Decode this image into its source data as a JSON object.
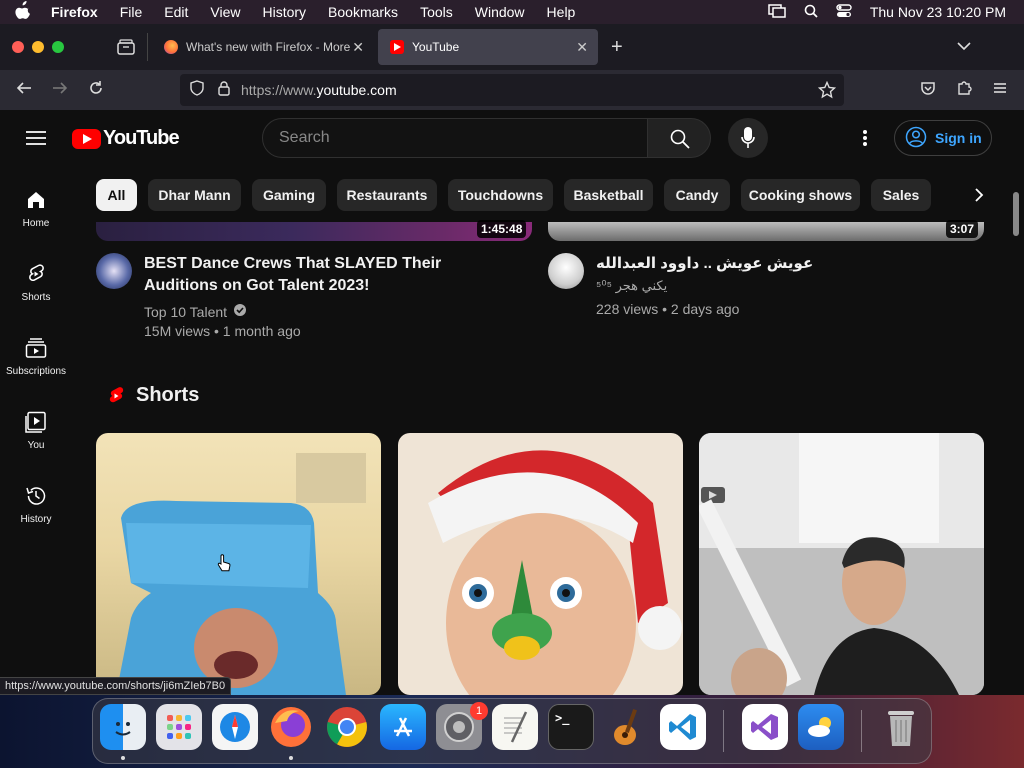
{
  "menubar": {
    "app": "Firefox",
    "items": [
      "File",
      "Edit",
      "View",
      "History",
      "Bookmarks",
      "Tools",
      "Window",
      "Help"
    ],
    "clock": "Thu Nov 23  10:20 PM"
  },
  "tabs": [
    {
      "title": "What's new with Firefox - More",
      "active": false
    },
    {
      "title": "YouTube",
      "active": true
    }
  ],
  "address": {
    "prefix": "https://www.",
    "domain": "youtube.com"
  },
  "youtube": {
    "logo": "YouTube",
    "search_placeholder": "Search",
    "signin_label": "Sign in",
    "chips": [
      "All",
      "Dhar Mann",
      "Gaming",
      "Restaurants",
      "Touchdowns",
      "Basketball",
      "Candy",
      "Cooking shows",
      "Sales"
    ],
    "sidebar": [
      {
        "label": "Home",
        "icon": "home-icon"
      },
      {
        "label": "Shorts",
        "icon": "shorts-icon"
      },
      {
        "label": "Subscriptions",
        "icon": "subscriptions-icon"
      },
      {
        "label": "You",
        "icon": "you-icon"
      },
      {
        "label": "History",
        "icon": "history-icon"
      }
    ],
    "videos": [
      {
        "title": "BEST Dance Crews That SLAYED Their Auditions on Got Talent 2023!",
        "channel": "Top 10 Talent",
        "verified": true,
        "stats": "15M views • 1 month ago",
        "duration": "1:45:48"
      },
      {
        "title": "عويش عويش .. داوود العبدالله",
        "channel": "يكني هجر ⁵⁰⁵",
        "verified": false,
        "stats": "228 views • 2 days ago",
        "duration": "3:07"
      }
    ],
    "shorts_heading": "Shorts",
    "status_url": "https://www.youtube.com/shorts/ji6mZIeb7B0"
  },
  "dock": {
    "badge": "1"
  },
  "colors": {
    "accent_red": "#ff0000",
    "link_blue": "#3ea6ff",
    "background": "#0f0f0f"
  }
}
